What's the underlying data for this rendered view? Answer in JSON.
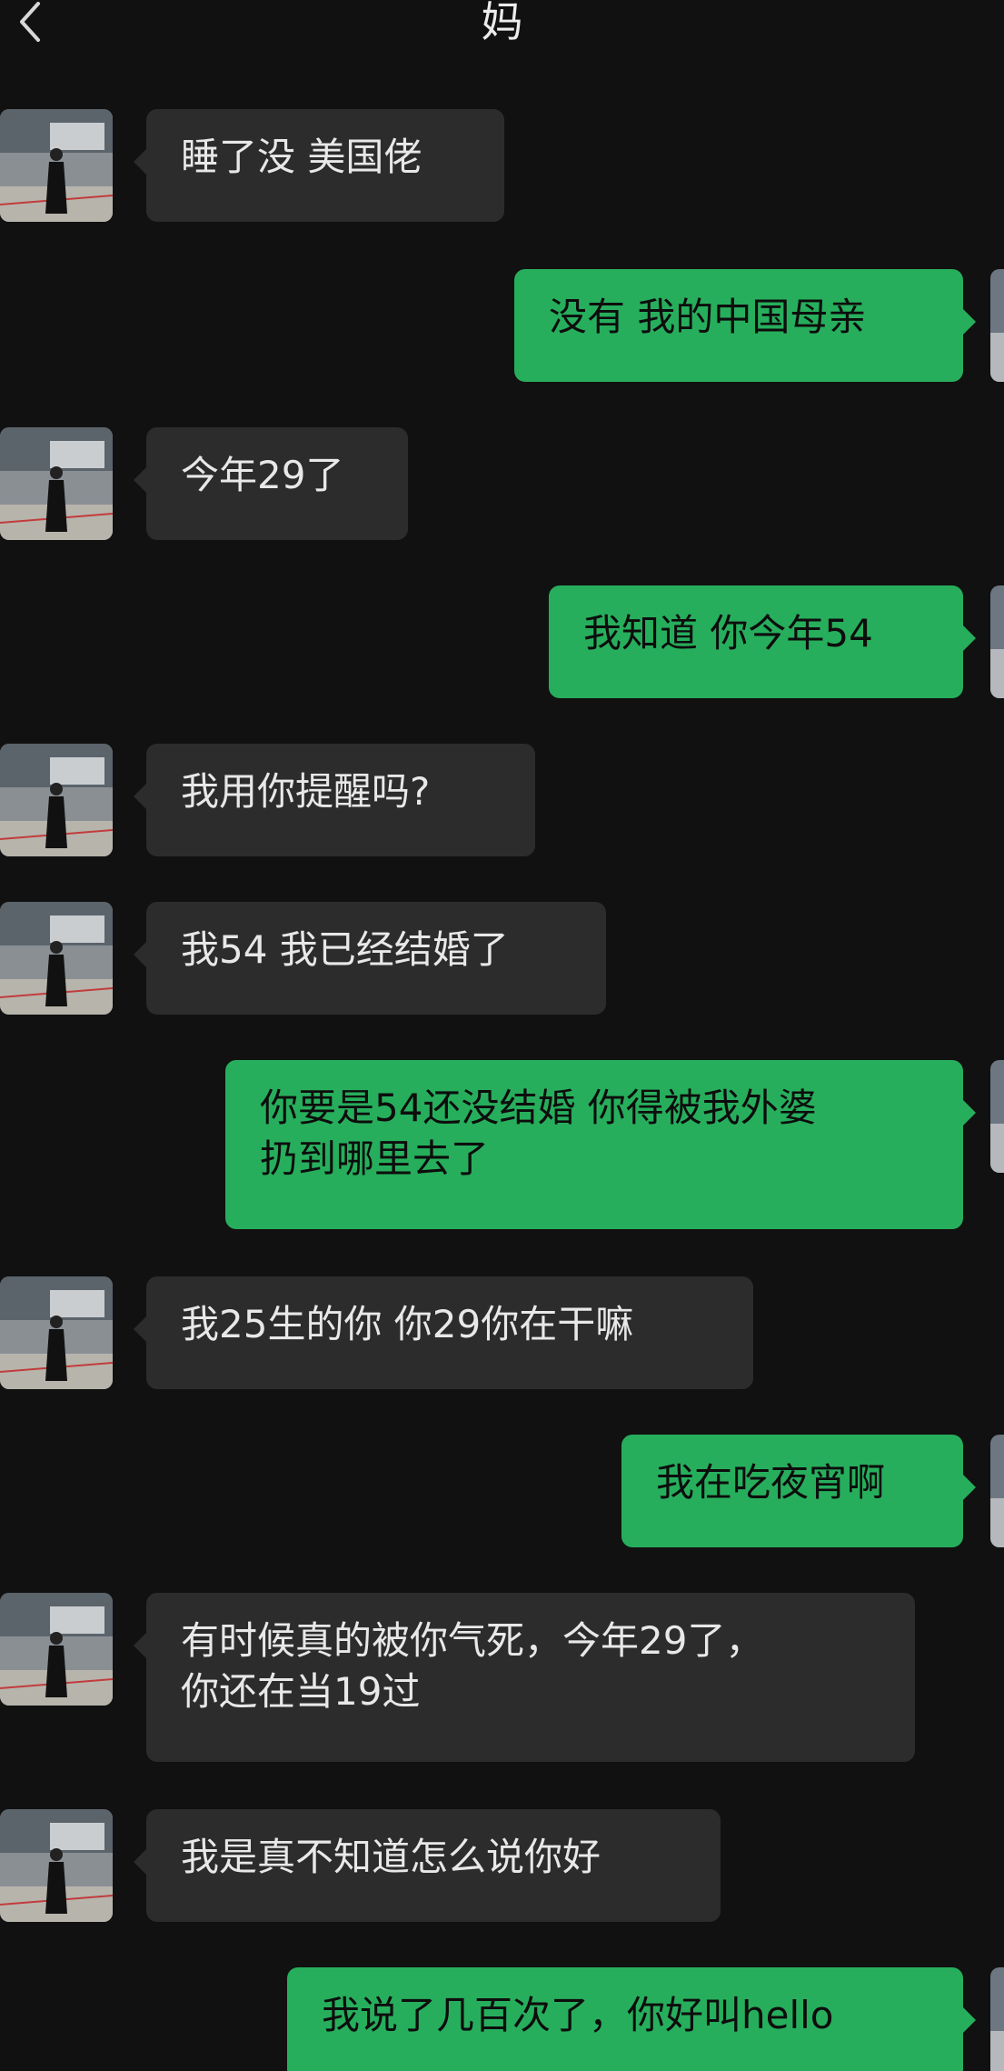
{
  "header": {
    "title": "妈",
    "back_icon": "chevron-left-icon"
  },
  "colors": {
    "background": "#111111",
    "incoming_bubble": "#2c2c2c",
    "outgoing_bubble": "#27ae5c"
  },
  "messages": [
    {
      "from": "mom",
      "text": "睡了没 美国佬"
    },
    {
      "from": "me",
      "text": "没有 我的中国母亲"
    },
    {
      "from": "mom",
      "text": "今年29了"
    },
    {
      "from": "me",
      "text": "我知道 你今年54"
    },
    {
      "from": "mom",
      "text": "我用你提醒吗?"
    },
    {
      "from": "mom",
      "text": "我54 我已经结婚了"
    },
    {
      "from": "me",
      "text": "你要是54还没结婚 你得被我外婆\n扔到哪里去了"
    },
    {
      "from": "mom",
      "text": "我25生的你 你29你在干嘛"
    },
    {
      "from": "me",
      "text": "我在吃夜宵啊"
    },
    {
      "from": "mom",
      "text": "有时候真的被你气死，今年29了，\n你还在当19过"
    },
    {
      "from": "mom",
      "text": "我是真不知道怎么说你好"
    },
    {
      "from": "me",
      "text": "我说了几百次了，你好叫hello"
    }
  ]
}
